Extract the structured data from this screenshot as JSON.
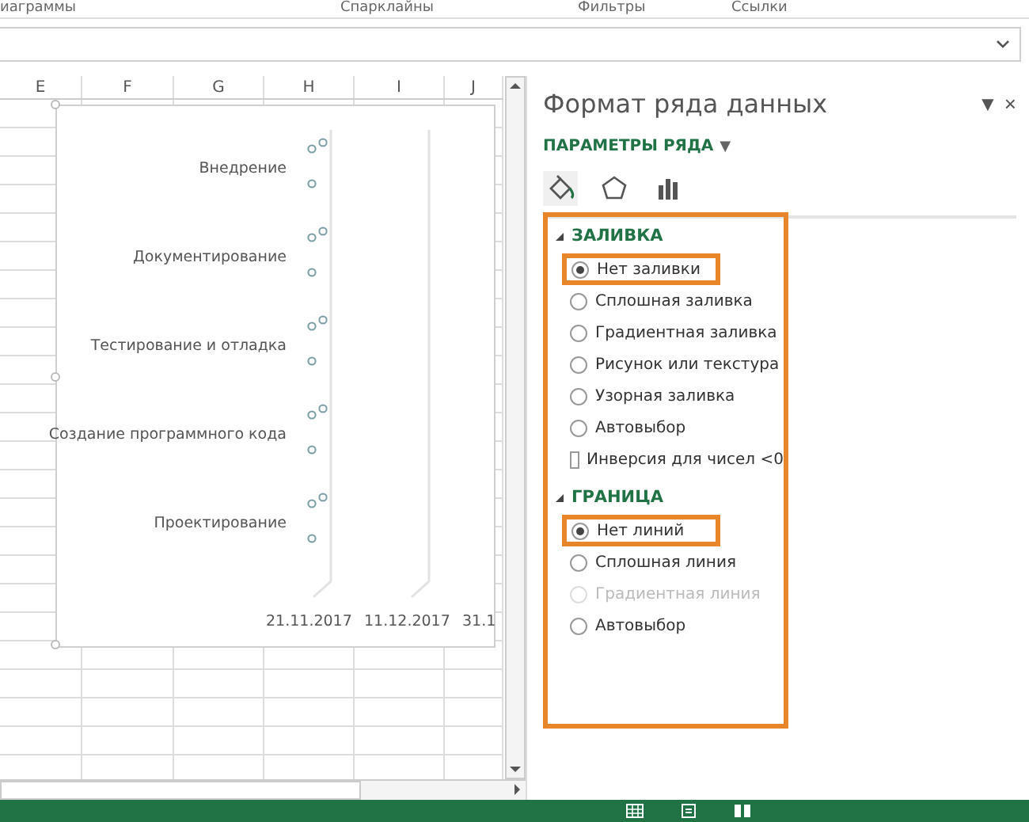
{
  "ribbon_groups": [
    "иаграммы",
    "Спарклайны",
    "Фильтры",
    "Ссылки"
  ],
  "sheet": {
    "columns": [
      "E",
      "F",
      "G",
      "H",
      "I",
      "J"
    ]
  },
  "chart": {
    "categories": [
      "Внедрение",
      "Документирование",
      "Тестирование и отладка",
      "Создание программного кода",
      "Проектирование"
    ],
    "date_labels": [
      "21.11.2017",
      "11.12.2017",
      "31.1"
    ]
  },
  "pane": {
    "title": "Формат ряда данных",
    "menu_button": "▼",
    "close_button": "×",
    "options_label": "ПАРАМЕТРЫ РЯДА",
    "options_caret": "▼",
    "tabs": [
      {
        "kind": "fill",
        "selected": true
      },
      {
        "kind": "shape",
        "selected": false
      },
      {
        "kind": "bars",
        "selected": false
      }
    ],
    "sections": [
      {
        "title": "ЗАЛИВКА",
        "expanded": true,
        "options": [
          {
            "kind": "radio",
            "label": "Нет заливки",
            "selected": true,
            "disabled": false,
            "highlighted": true
          },
          {
            "kind": "radio",
            "label": "Сплошная заливка",
            "selected": false,
            "disabled": false,
            "highlighted": false
          },
          {
            "kind": "radio",
            "label": "Градиентная заливка",
            "selected": false,
            "disabled": false,
            "highlighted": false
          },
          {
            "kind": "radio",
            "label": "Рисунок или текстура",
            "selected": false,
            "disabled": false,
            "highlighted": false
          },
          {
            "kind": "radio",
            "label": "Узорная заливка",
            "selected": false,
            "disabled": false,
            "highlighted": false
          },
          {
            "kind": "radio",
            "label": "Автовыбор",
            "selected": false,
            "disabled": false,
            "highlighted": false
          },
          {
            "kind": "checkbox",
            "label": "Инверсия для чисел <0",
            "checked": false,
            "disabled": false,
            "highlighted": false
          }
        ]
      },
      {
        "title": "ГРАНИЦА",
        "expanded": true,
        "options": [
          {
            "kind": "radio",
            "label": "Нет линий",
            "selected": true,
            "disabled": false,
            "highlighted": true
          },
          {
            "kind": "radio",
            "label": "Сплошная линия",
            "selected": false,
            "disabled": false,
            "highlighted": false
          },
          {
            "kind": "radio",
            "label": "Градиентная линия",
            "selected": false,
            "disabled": true,
            "highlighted": false
          },
          {
            "kind": "radio",
            "label": "Автовыбор",
            "selected": false,
            "disabled": false,
            "highlighted": false
          }
        ]
      }
    ]
  }
}
